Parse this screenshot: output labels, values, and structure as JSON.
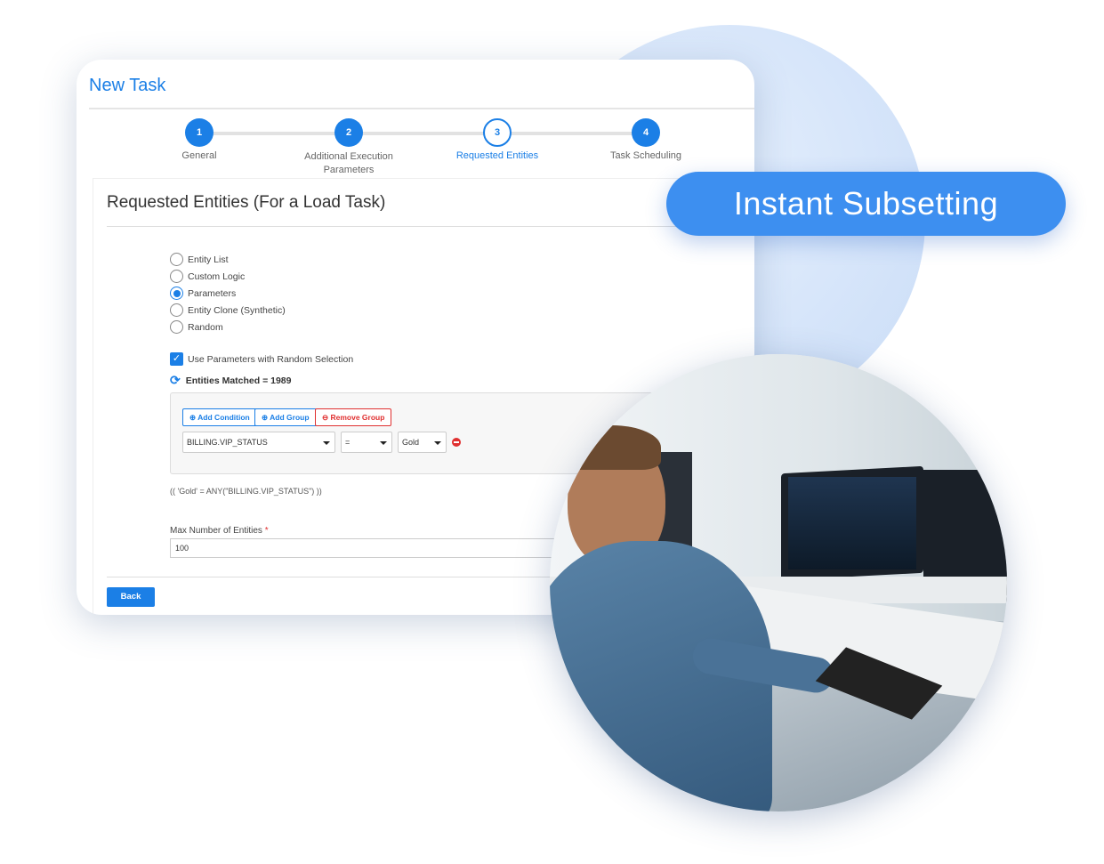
{
  "dialog": {
    "title": "New Task"
  },
  "steps": [
    {
      "num": "1",
      "label": "General",
      "state": "done"
    },
    {
      "num": "2",
      "label": "Additional Execution Parameters",
      "state": "done"
    },
    {
      "num": "3",
      "label": "Requested Entities",
      "state": "active"
    },
    {
      "num": "4",
      "label": "Task Scheduling",
      "state": "done"
    }
  ],
  "section": {
    "title": "Requested Entities (For a Load Task)"
  },
  "options": [
    {
      "label": "Entity List",
      "selected": false
    },
    {
      "label": "Custom Logic",
      "selected": false
    },
    {
      "label": "Parameters",
      "selected": true
    },
    {
      "label": "Entity Clone (Synthetic)",
      "selected": false
    },
    {
      "label": "Random",
      "selected": false
    }
  ],
  "random_checkbox": {
    "label": "Use Parameters with Random Selection",
    "checked": true
  },
  "entities_matched": "Entities Matched = 1989",
  "query": {
    "add_condition": "Add Condition",
    "add_group": "Add Group",
    "remove_group": "Remove Group",
    "field": "BILLING.VIP_STATUS",
    "operator": "=",
    "value": "Gold",
    "expression": "(( 'Gold' = ANY(\"BILLING.VIP_STATUS\") ))"
  },
  "max_entities": {
    "label": "Max Number of Entities",
    "required_mark": "*",
    "value": "100"
  },
  "back_label": "Back",
  "banner": "Instant Subsetting",
  "colors": {
    "accent": "#1b7fe6",
    "danger": "#e03030",
    "banner": "#3d8ff0"
  }
}
